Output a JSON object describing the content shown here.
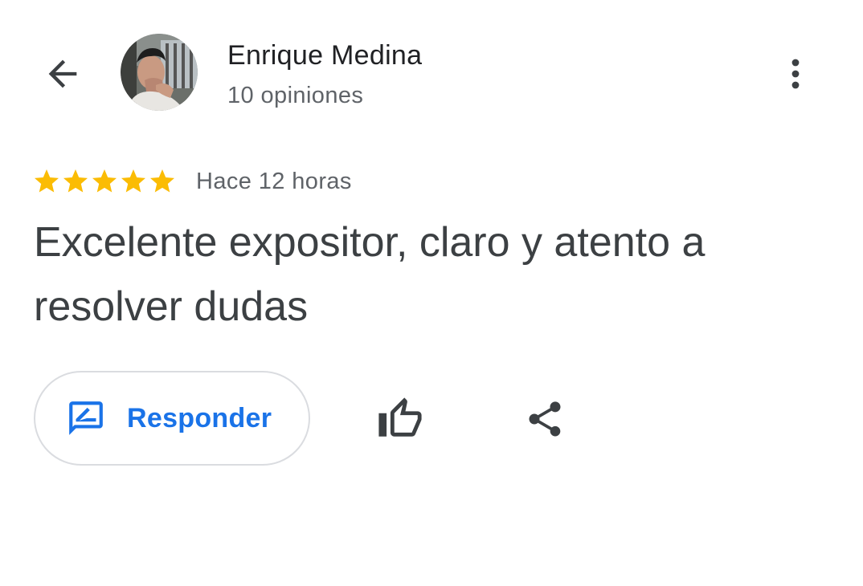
{
  "header": {
    "back_icon": "arrow-back-icon",
    "author_name": "Enrique Medina",
    "review_count": "10 opiniones",
    "more_icon": "more-vert-icon"
  },
  "review": {
    "rating": 5,
    "rating_max": 5,
    "time": "Hace 12 horas",
    "text": "Excelente expositor, claro y atento a resolver dudas"
  },
  "actions": {
    "reply_label": "Responder",
    "reply_icon": "rate-review-icon",
    "like_icon": "thumb-up-outline-icon",
    "share_icon": "share-icon"
  },
  "colors": {
    "star": "#fbbc04",
    "accent": "#1a73e8",
    "text_primary": "#202124",
    "text_secondary": "#5f6368",
    "border": "#dadce0"
  }
}
